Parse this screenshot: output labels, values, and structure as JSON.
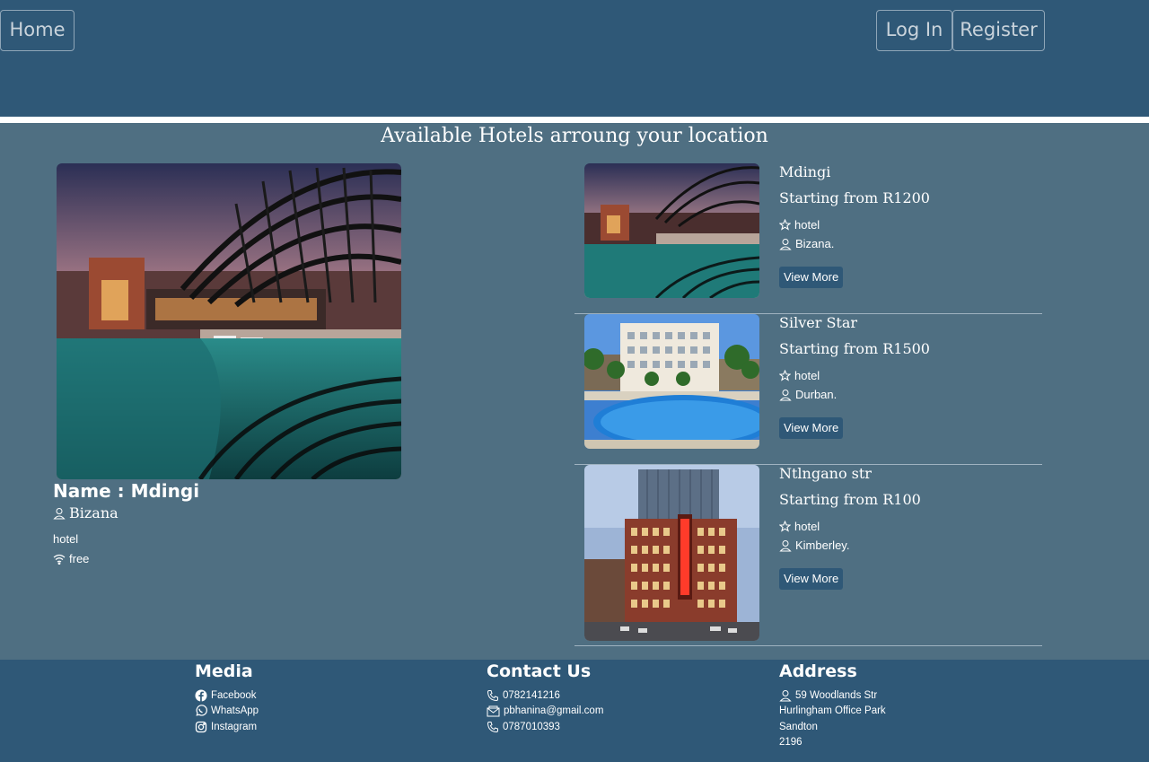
{
  "nav": {
    "home": "Home",
    "login": "Log In",
    "register": "Register"
  },
  "main": {
    "heading": "Available Hotels arroung your location",
    "feature": {
      "name": "Name : Mdingi",
      "location": "Bizana",
      "type": "hotel",
      "wifi": "free"
    },
    "hotels": [
      {
        "name": "Mdingi",
        "price": "Starting from R1200",
        "type": "hotel",
        "location": "Bizana.",
        "button": "View More"
      },
      {
        "name": "Silver Star",
        "price": "Starting from R1500",
        "type": "hotel",
        "location": "Durban.",
        "button": "View More"
      },
      {
        "name": "Ntlngano str",
        "price": "Starting from R100",
        "type": "hotel",
        "location": "Kimberley.",
        "button": "View More"
      }
    ]
  },
  "footer": {
    "media": {
      "title": "Media",
      "items": [
        "Facebook",
        "WhatsApp",
        "Instagram"
      ]
    },
    "contact": {
      "title": "Contact Us",
      "items": [
        "0782141216",
        "pbhanina@gmail.com",
        "0787010393"
      ]
    },
    "address": {
      "title": "Address",
      "lines": [
        "59 Woodlands Str",
        "Hurlingham Office Park",
        "Sandton",
        "2196"
      ]
    }
  },
  "colors": {
    "navbar": "#2f5877",
    "main_bg": "#4f6f82",
    "button_bg": "#2f5877"
  }
}
